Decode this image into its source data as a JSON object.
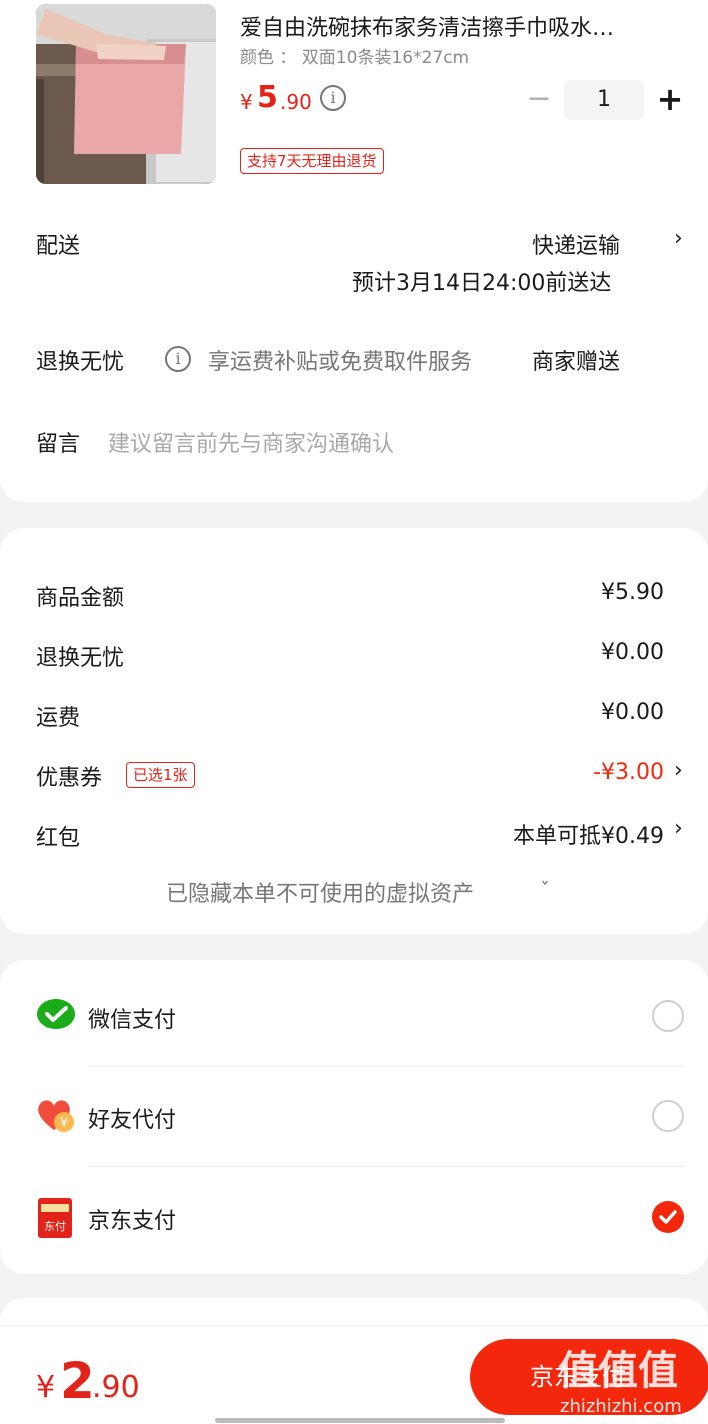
{
  "product": {
    "title": "爱自由洗碗抹布家务清洁擦手巾吸水…",
    "spec": "颜色 ： 双面10条装16*27cm",
    "price_yen": "¥",
    "price_int": "5",
    "price_dec": ".90",
    "info_symbol": "i",
    "qty_minus": "−",
    "qty": "1",
    "qty_plus": "+",
    "return_tag": "支持7天无理由退货"
  },
  "delivery": {
    "label": "配送",
    "method": "快递运输",
    "eta": "预计3月14日24:00前送达",
    "chevron": "›"
  },
  "worry_free": {
    "label": "退换无忧",
    "info_symbol": "i",
    "desc": "享运费补贴或免费取件服务",
    "value": "商家赠送"
  },
  "message": {
    "label": "留言",
    "placeholder": "建议留言前先与商家沟通确认"
  },
  "summary": {
    "rows": [
      {
        "label": "商品金额",
        "value": "¥5.90"
      },
      {
        "label": "退换无忧",
        "value": "¥0.00"
      },
      {
        "label": "运费",
        "value": "¥0.00"
      }
    ],
    "coupon": {
      "label": "优惠券",
      "badge": "已选1张",
      "value": "-¥3.00"
    },
    "red_packet": {
      "label": "红包",
      "value": "本单可抵¥0.49"
    },
    "hidden_assets": "已隐藏本单不可使用的虚拟资产",
    "expand_symbol": "ˇ",
    "chevron": "›"
  },
  "payment": {
    "methods": [
      {
        "label": "微信支付",
        "checked": false
      },
      {
        "label": "好友代付",
        "checked": false
      },
      {
        "label": "京东支付",
        "checked": true
      }
    ],
    "jd_icon_text": "东付",
    "friend_icon_text": "¥"
  },
  "footer": {
    "total_yen": "¥",
    "total_int": "2",
    "total_dec": ".90",
    "pay_button": "京东支付"
  },
  "watermark": {
    "big": "值值值",
    "url": "zhizhizhi.com"
  },
  "colors": {
    "accent": "#f2270c",
    "price_red": "#e2231a",
    "background": "#f2f2f2",
    "wechat_green": "#1aad19"
  }
}
